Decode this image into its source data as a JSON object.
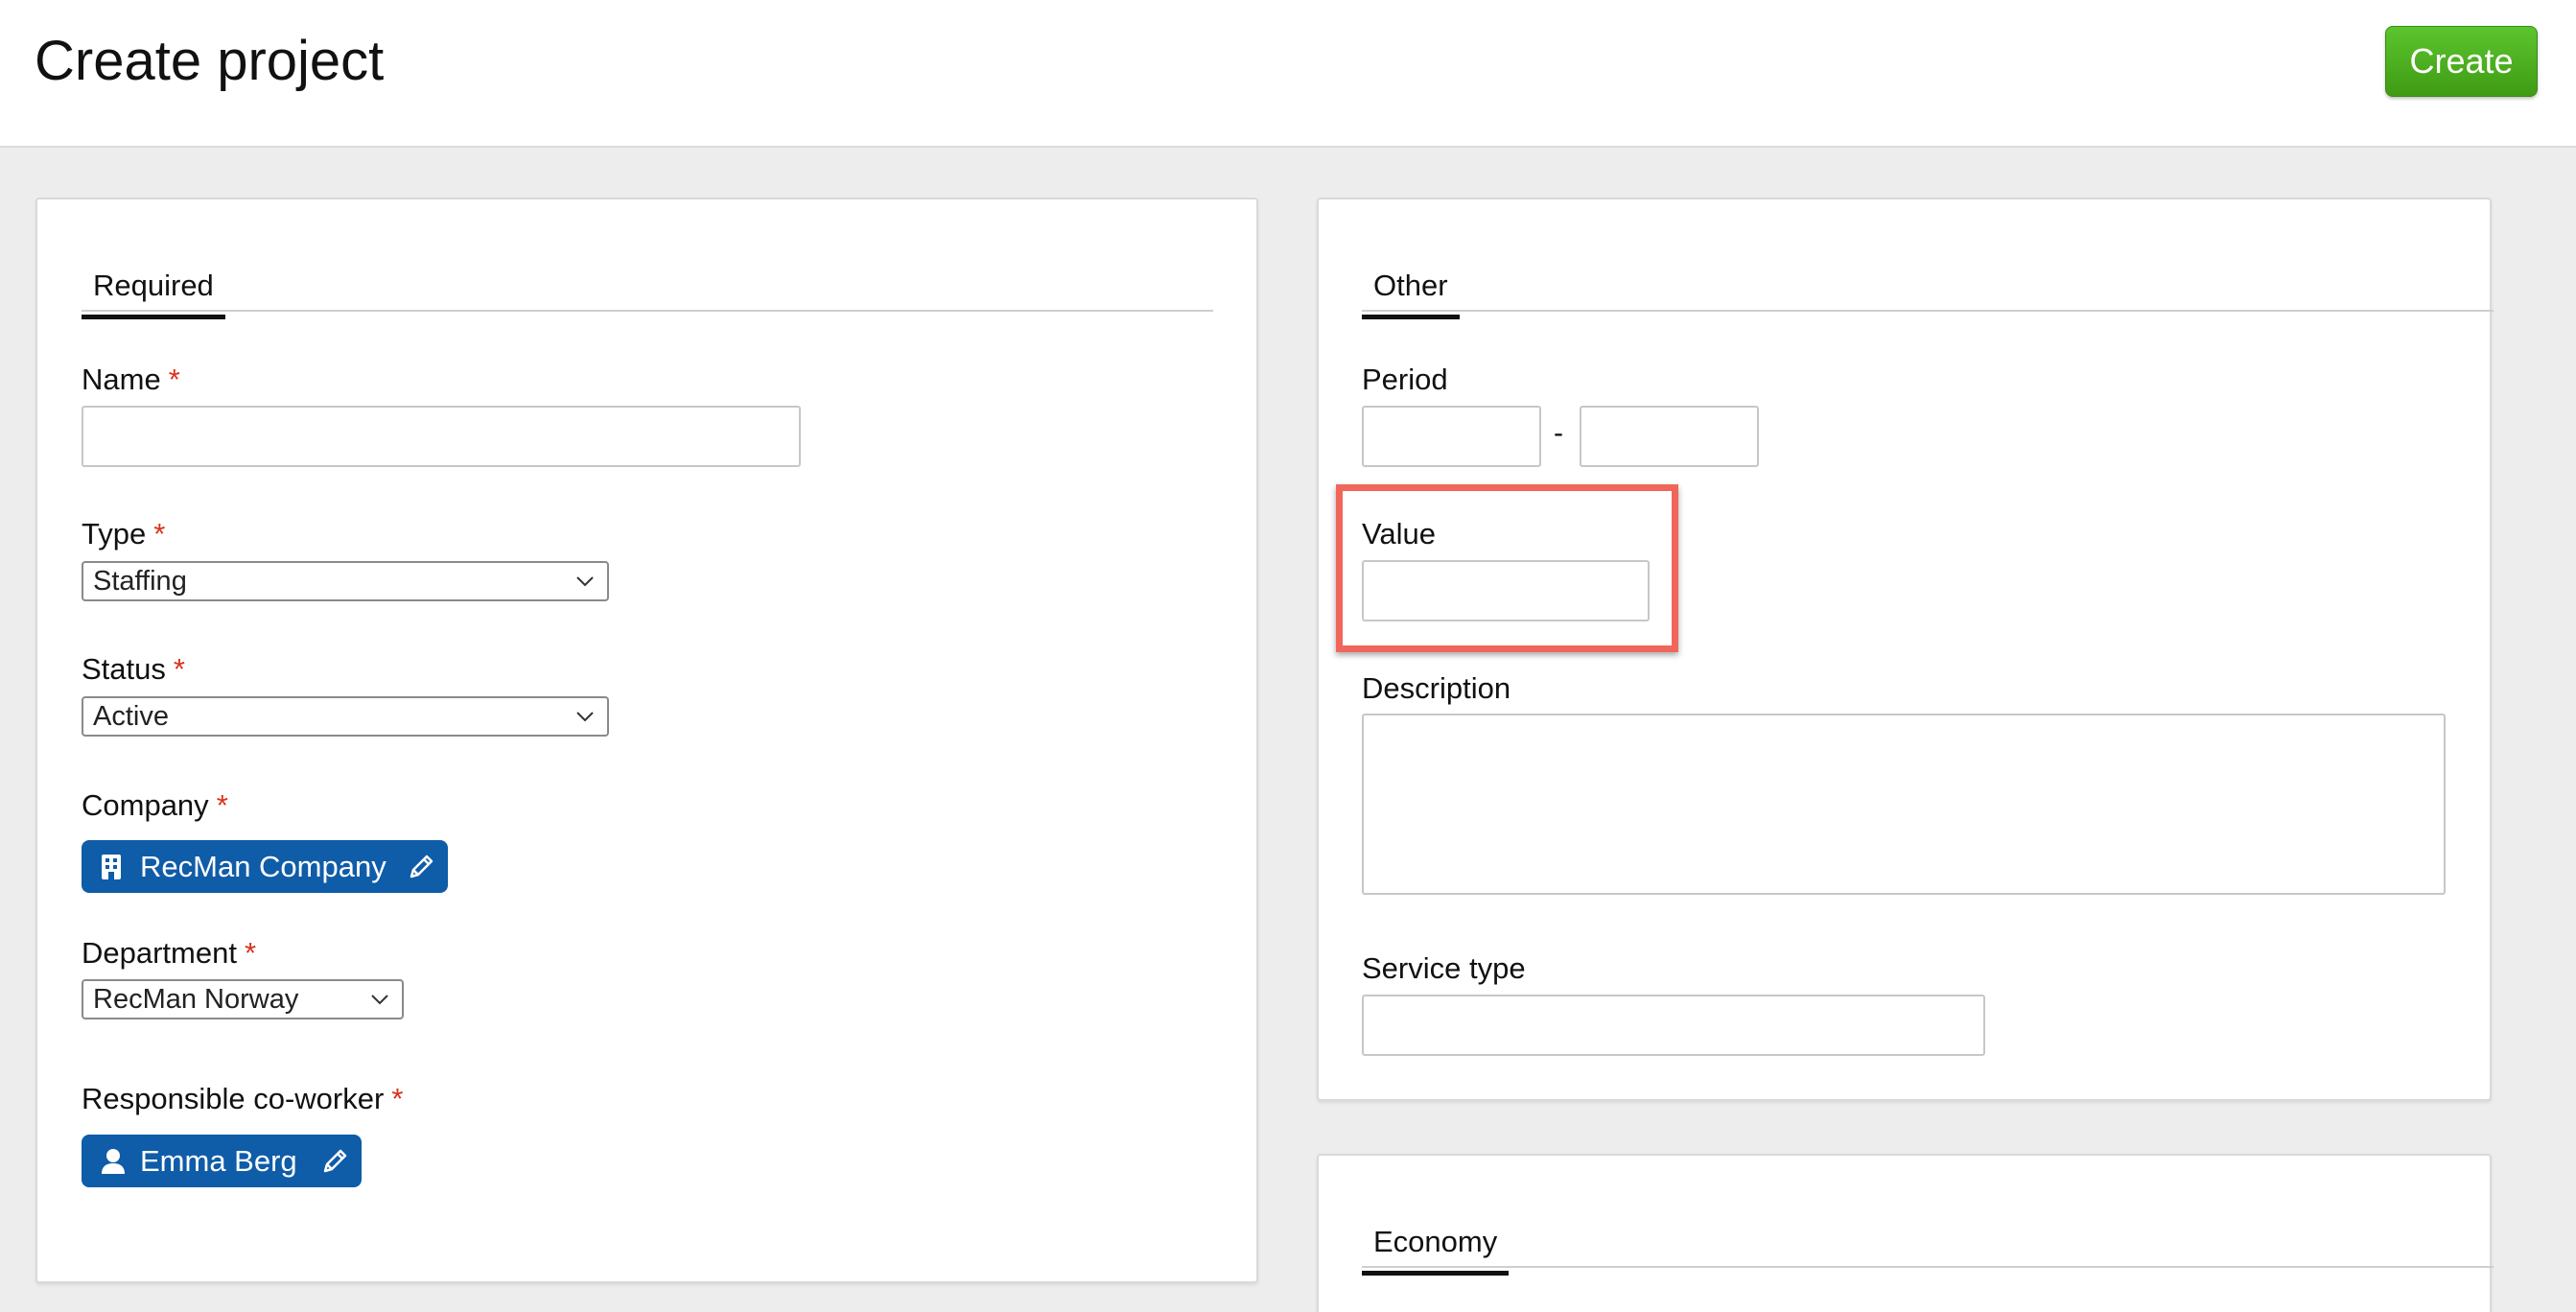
{
  "header": {
    "title": "Create project",
    "create_label": "Create",
    "create_color": "#4cae22"
  },
  "required_section": {
    "tab_label": "Required",
    "required_marker": "*",
    "name": {
      "label": "Name",
      "value": "",
      "placeholder": ""
    },
    "type": {
      "label": "Type",
      "selected": "Staffing"
    },
    "status": {
      "label": "Status",
      "selected": "Active"
    },
    "company": {
      "label": "Company",
      "chip_text": "RecMan Company",
      "icon": "building-icon",
      "edit_icon": "pencil-icon"
    },
    "department": {
      "label": "Department",
      "selected": "RecMan Norway"
    },
    "responsible": {
      "label": "Responsible co-worker",
      "chip_text": "Emma Berg",
      "icon": "person-icon",
      "edit_icon": "pencil-icon"
    }
  },
  "other_section": {
    "tab_label": "Other",
    "period": {
      "label": "Period",
      "from_value": "",
      "to_value": "",
      "separator": "-"
    },
    "value": {
      "label": "Value",
      "value": "",
      "highlighted": true,
      "highlight_color": "#f0665b"
    },
    "description": {
      "label": "Description",
      "value": ""
    },
    "service_type": {
      "label": "Service type",
      "value": ""
    }
  },
  "economy_section": {
    "tab_label": "Economy"
  },
  "colors": {
    "chip_blue": "#0f5ca8",
    "required_red": "#d9331a",
    "page_bg": "#ededed"
  }
}
